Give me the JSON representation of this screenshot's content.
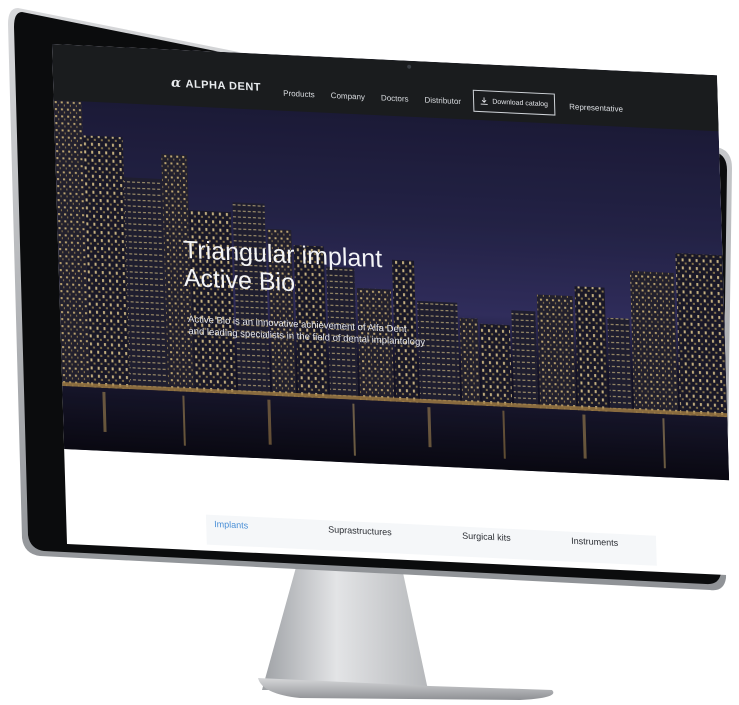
{
  "header": {
    "logo_symbol": "α",
    "logo_text": "ALPHA DENT",
    "nav": [
      "Products",
      "Company",
      "Doctors",
      "Distributor"
    ],
    "download_label": "Download catalog",
    "download_icon": "download-icon",
    "representative_label": "Representative"
  },
  "hero": {
    "title_line1": "Triangular implant",
    "title_line2": "Active Bio",
    "subtitle_line1": "Active Bio is an innovative achievement of Alfa Dent",
    "subtitle_line2": "and leading specialists in the field of dental implantology"
  },
  "categories": [
    "Implants",
    "Suprastructures",
    "Surgical kits",
    "Instruments"
  ],
  "colors": {
    "accent": "#4a8fd6",
    "topbar": "#1a1c1e",
    "bezel": "#0b0c0d",
    "stand": "#c9cbce"
  }
}
